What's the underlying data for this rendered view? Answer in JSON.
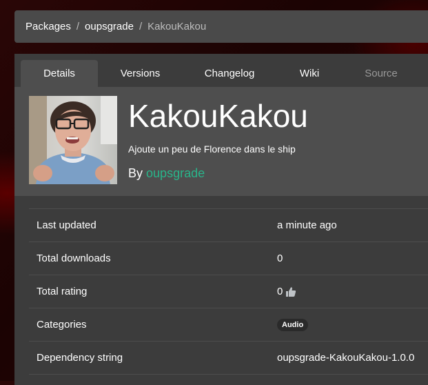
{
  "breadcrumb": {
    "items": [
      "Packages",
      "oupsgrade"
    ],
    "current": "KakouKakou",
    "separator": "/"
  },
  "tabs": [
    {
      "label": "Details",
      "active": true
    },
    {
      "label": "Versions"
    },
    {
      "label": "Changelog"
    },
    {
      "label": "Wiki"
    },
    {
      "label": "Source",
      "disabled": true
    }
  ],
  "package": {
    "name": "KakouKakou",
    "description": "Ajoute un peu de Florence dans le ship",
    "by_prefix": "By",
    "author": "oupsgrade"
  },
  "details": {
    "last_updated": {
      "label": "Last updated",
      "value": "a minute ago"
    },
    "total_downloads": {
      "label": "Total downloads",
      "value": "0"
    },
    "total_rating": {
      "label": "Total rating",
      "value": "0"
    },
    "categories": {
      "label": "Categories",
      "value": "Audio"
    },
    "dependency": {
      "label": "Dependency string",
      "value": "oupsgrade-KakouKakou-1.0.0"
    }
  },
  "colors": {
    "accent": "#29b58a",
    "card": "#3c3c3c",
    "header": "#4e4e4e",
    "breadcrumb": "#4a4a4a"
  },
  "icons": {
    "rating": "thumbs-up-icon"
  }
}
